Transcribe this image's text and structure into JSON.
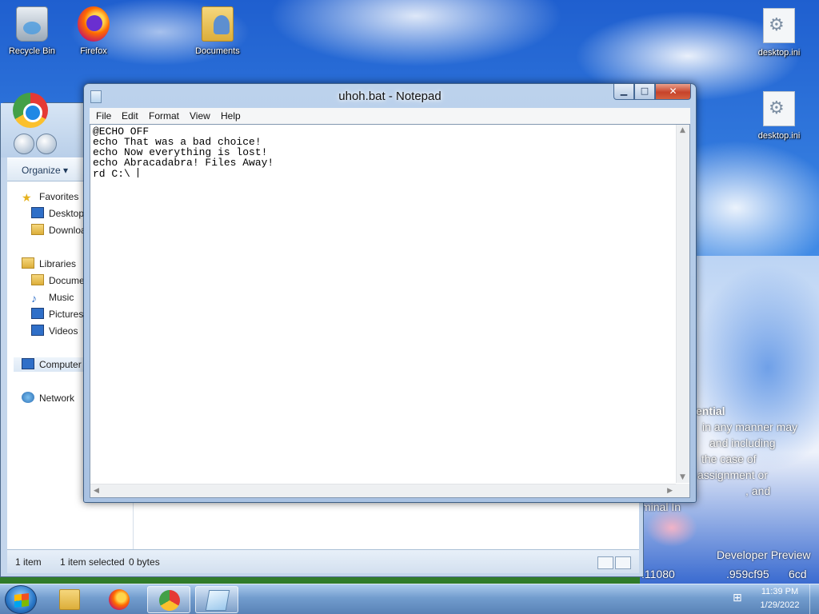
{
  "desktop": {
    "icons": [
      {
        "label": "Recycle Bin"
      },
      {
        "label": "Firefox"
      },
      {
        "label": "Documents"
      },
      {
        "label": "desktop.ini"
      },
      {
        "label": "desktop.ini"
      }
    ],
    "wallpaper_text": [
      "ential",
      "in any manner may",
      "and including",
      "the case of",
      "assignment or",
      ", and",
      "minal In",
      "Developer Preview",
      ".11080",
      ".959cf95",
      "6cd"
    ]
  },
  "explorer": {
    "organize_label": "Organize",
    "nav": {
      "favorites": "Favorites",
      "desktop": "Desktop",
      "downloads": "Downloa",
      "libraries": "Libraries",
      "documents": "Docume",
      "music": "Music",
      "pictures": "Pictures",
      "videos": "Videos",
      "computer": "Computer",
      "network": "Network"
    },
    "status": {
      "count": "1 item",
      "selected": "1 item selected",
      "size": "0 bytes"
    }
  },
  "notepad": {
    "title": "uhoh.bat - Notepad",
    "menu": [
      "File",
      "Edit",
      "Format",
      "View",
      "Help"
    ],
    "content": "@ECHO OFF\necho That was a bad choice!\necho Now everything is lost!\necho Abracadabra! Files Away!\nrd C:\\ ",
    "caption_buttons": {
      "minimize": "▁",
      "maximize": "□",
      "close": "✕"
    }
  },
  "taskbar": {
    "time": "11:39 PM",
    "date": "1/29/2022",
    "network_icon": "⊞"
  }
}
